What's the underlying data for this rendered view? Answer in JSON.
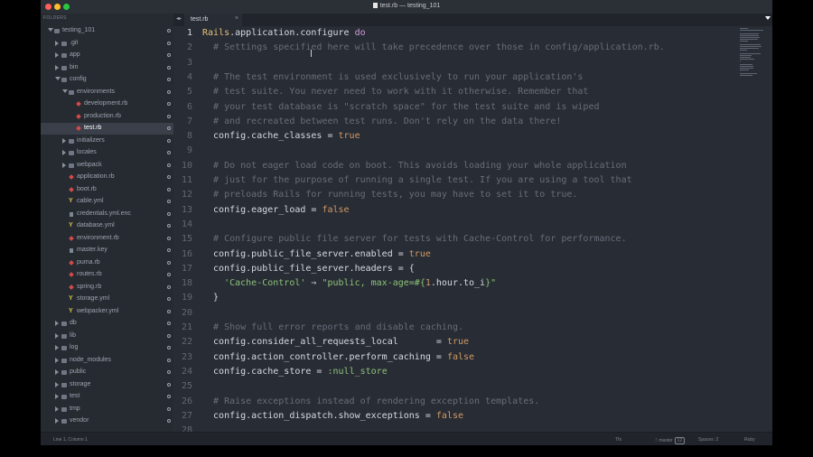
{
  "window": {
    "title": "test.rb — testing_101"
  },
  "sidebar": {
    "header": "FOLDERS",
    "items": [
      {
        "label": "testing_101",
        "depth": 0,
        "kind": "folder-open",
        "active": false
      },
      {
        "label": ".git",
        "depth": 1,
        "kind": "folder",
        "active": false
      },
      {
        "label": "app",
        "depth": 1,
        "kind": "folder",
        "active": false
      },
      {
        "label": "bin",
        "depth": 1,
        "kind": "folder",
        "active": false
      },
      {
        "label": "config",
        "depth": 1,
        "kind": "folder-open",
        "active": false
      },
      {
        "label": "environments",
        "depth": 2,
        "kind": "folder-open",
        "active": false
      },
      {
        "label": "development.rb",
        "depth": 3,
        "kind": "ruby",
        "active": false
      },
      {
        "label": "production.rb",
        "depth": 3,
        "kind": "ruby",
        "active": false
      },
      {
        "label": "test.rb",
        "depth": 3,
        "kind": "ruby",
        "active": true
      },
      {
        "label": "initializers",
        "depth": 2,
        "kind": "folder",
        "active": false
      },
      {
        "label": "locales",
        "depth": 2,
        "kind": "folder",
        "active": false
      },
      {
        "label": "webpack",
        "depth": 2,
        "kind": "folder",
        "active": false
      },
      {
        "label": "application.rb",
        "depth": 2,
        "kind": "ruby",
        "active": false
      },
      {
        "label": "boot.rb",
        "depth": 2,
        "kind": "ruby",
        "active": false
      },
      {
        "label": "cable.yml",
        "depth": 2,
        "kind": "yml",
        "active": false
      },
      {
        "label": "credentials.yml.enc",
        "depth": 2,
        "kind": "doc",
        "active": false
      },
      {
        "label": "database.yml",
        "depth": 2,
        "kind": "yml",
        "active": false
      },
      {
        "label": "environment.rb",
        "depth": 2,
        "kind": "ruby",
        "active": false
      },
      {
        "label": "master.key",
        "depth": 2,
        "kind": "doc",
        "active": false
      },
      {
        "label": "puma.rb",
        "depth": 2,
        "kind": "ruby",
        "active": false
      },
      {
        "label": "routes.rb",
        "depth": 2,
        "kind": "ruby",
        "active": false
      },
      {
        "label": "spring.rb",
        "depth": 2,
        "kind": "ruby",
        "active": false
      },
      {
        "label": "storage.yml",
        "depth": 2,
        "kind": "yml",
        "active": false
      },
      {
        "label": "webpacker.yml",
        "depth": 2,
        "kind": "yml",
        "active": false
      },
      {
        "label": "db",
        "depth": 1,
        "kind": "folder",
        "active": false
      },
      {
        "label": "lib",
        "depth": 1,
        "kind": "folder",
        "active": false
      },
      {
        "label": "log",
        "depth": 1,
        "kind": "folder",
        "active": false
      },
      {
        "label": "node_modules",
        "depth": 1,
        "kind": "folder",
        "active": false
      },
      {
        "label": "public",
        "depth": 1,
        "kind": "folder",
        "active": false
      },
      {
        "label": "storage",
        "depth": 1,
        "kind": "folder",
        "active": false
      },
      {
        "label": "test",
        "depth": 1,
        "kind": "folder",
        "active": false
      },
      {
        "label": "tmp",
        "depth": 1,
        "kind": "folder",
        "active": false
      },
      {
        "label": "vendor",
        "depth": 1,
        "kind": "folder",
        "active": false
      }
    ]
  },
  "tabs": [
    {
      "label": "test.rb",
      "active": true
    }
  ],
  "tab_nav_icon": "chevron-left-right-icon",
  "tab_close_glyph": "×",
  "current_line": 1,
  "code_lines": [
    [
      [
        "cls",
        "Rails"
      ],
      [
        "op",
        ".application.configure "
      ],
      [
        "kw",
        "do"
      ]
    ],
    [
      [
        "cmt",
        "  # Settings specified here will take precedence over those in config/application.rb."
      ]
    ],
    [],
    [
      [
        "cmt",
        "  # The test environment is used exclusively to run your application's"
      ]
    ],
    [
      [
        "cmt",
        "  # test suite. You never need to work with it otherwise. Remember that"
      ]
    ],
    [
      [
        "cmt",
        "  # your test database is \"scratch space\" for the test suite and is wiped"
      ]
    ],
    [
      [
        "cmt",
        "  # and recreated between test runs. Don't rely on the data there!"
      ]
    ],
    [
      [
        "op",
        "  config.cache_classes = "
      ],
      [
        "bool",
        "true"
      ]
    ],
    [],
    [
      [
        "cmt",
        "  # Do not eager load code on boot. This avoids loading your whole application"
      ]
    ],
    [
      [
        "cmt",
        "  # just for the purpose of running a single test. If you are using a tool that"
      ]
    ],
    [
      [
        "cmt",
        "  # preloads Rails for running tests, you may have to set it to true."
      ]
    ],
    [
      [
        "op",
        "  config.eager_load = "
      ],
      [
        "bool",
        "false"
      ]
    ],
    [],
    [
      [
        "cmt",
        "  # Configure public file server for tests with Cache-Control for performance."
      ]
    ],
    [
      [
        "op",
        "  config.public_file_server.enabled = "
      ],
      [
        "bool",
        "true"
      ]
    ],
    [
      [
        "op",
        "  config.public_file_server.headers = {"
      ]
    ],
    [
      [
        "str",
        "    'Cache-Control'"
      ],
      [
        "op",
        " ⇒ "
      ],
      [
        "str",
        "\"public, max-age=#{"
      ],
      [
        "num",
        "1"
      ],
      [
        "op",
        ".hour.to_i"
      ],
      [
        "str",
        "}\""
      ]
    ],
    [
      [
        "op",
        "  }"
      ]
    ],
    [],
    [
      [
        "cmt",
        "  # Show full error reports and disable caching."
      ]
    ],
    [
      [
        "op",
        "  config.consider_all_requests_local       = "
      ],
      [
        "bool",
        "true"
      ]
    ],
    [
      [
        "op",
        "  config.action_controller.perform_caching = "
      ],
      [
        "bool",
        "false"
      ]
    ],
    [
      [
        "op",
        "  config.cache_store = "
      ],
      [
        "sym",
        ":null_store"
      ]
    ],
    [],
    [
      [
        "cmt",
        "  # Raise exceptions instead of rendering exception templates."
      ]
    ],
    [
      [
        "op",
        "  config.action_dispatch.show_exceptions = "
      ],
      [
        "bool",
        "false"
      ]
    ],
    []
  ],
  "line_numbers": [
    "1",
    "2",
    "3",
    "4",
    "5",
    "6",
    "7",
    "8",
    "9",
    "10",
    "11",
    "12",
    "13",
    "14",
    "15",
    "16",
    "17",
    "18",
    "19",
    "20",
    "21",
    "22",
    "23",
    "24",
    "25",
    "26",
    "27",
    "28"
  ],
  "statusbar": {
    "position": "Line 1, Column 1",
    "encoding": "Tfs",
    "branch": "master",
    "branch_count": "12",
    "indentation": "Spaces: 2",
    "syntax": "Ruby"
  },
  "colors": {
    "background": "#282c34",
    "sidebar": "#262a31",
    "comment": "#676e7a",
    "keyword": "#cf9bd8",
    "class": "#e4c07b",
    "boolean": "#d19a66",
    "string": "#8cc279"
  }
}
